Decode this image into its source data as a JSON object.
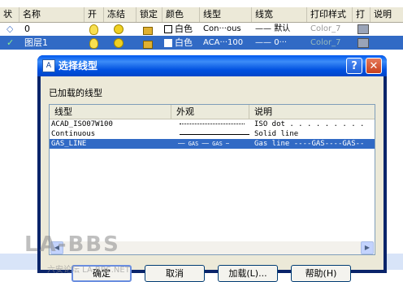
{
  "layer_table": {
    "columns": [
      "状",
      "名称",
      "开",
      "冻结",
      "锁定",
      "颜色",
      "线型",
      "线宽",
      "打印样式",
      "打",
      "说明"
    ],
    "rows": [
      {
        "status": "◇",
        "name": "0",
        "color": "白色",
        "linetype": "Con···ous",
        "lineweight": "默认",
        "plot_style": "Color_7"
      },
      {
        "status": "✓",
        "name": "图层1",
        "color": "白色",
        "linetype": "ACA···100",
        "lineweight": "0···",
        "plot_style": "Color_7"
      }
    ]
  },
  "dialog": {
    "title": "选择线型",
    "title_icon": "autocad-icon",
    "help_button": "?",
    "close_button": "✕",
    "loaded_label": "已加载的线型",
    "columns": [
      "线型",
      "外观",
      "说明"
    ],
    "linetypes": [
      {
        "name": "ACAD_ISO07W100",
        "appearance": "dot",
        "description": "ISO dot . . . . . . . . ."
      },
      {
        "name": "Continuous",
        "appearance": "solid",
        "description": "Solid line"
      },
      {
        "name": "GAS_LINE",
        "appearance": "gas",
        "description": "Gas line ----GAS----GAS--"
      }
    ],
    "selected_index": 2,
    "buttons": {
      "ok": "确定",
      "cancel": "取消",
      "load": "加载(L)...",
      "help": "帮助(H)"
    }
  },
  "watermark": {
    "main": "LA-BBS",
    "sub": "六安论坛 LA-BBS.NET"
  }
}
